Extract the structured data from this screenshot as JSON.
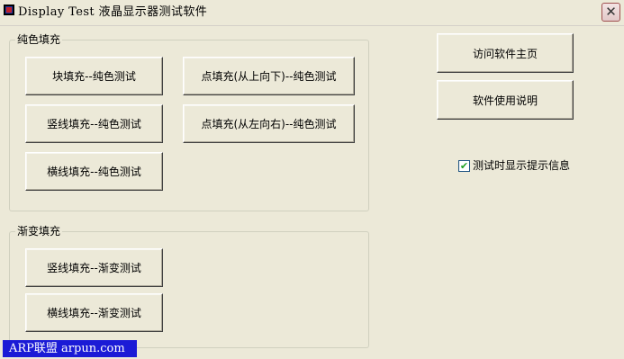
{
  "window": {
    "title": "Display Test 液晶显示器测试软件",
    "close_glyph": "✕"
  },
  "solid_fill": {
    "label": "纯色填充",
    "buttons": [
      "块填充--纯色测试",
      "点填充(从上向下)--纯色测试",
      "竖线填充--纯色测试",
      "点填充(从左向右)--纯色测试",
      "横线填充--纯色测试"
    ]
  },
  "gradient_fill": {
    "label": "渐变填充",
    "buttons": [
      "竖线填充--渐变测试",
      "横线填充--渐变测试"
    ]
  },
  "right_panel": {
    "homepage_button": "访问软件主页",
    "manual_button": "软件使用说明",
    "show_tips": {
      "label": "测试时显示提示信息",
      "checked": true,
      "check_glyph": "✔"
    }
  },
  "watermark": "ARP联盟 arpun.com"
}
